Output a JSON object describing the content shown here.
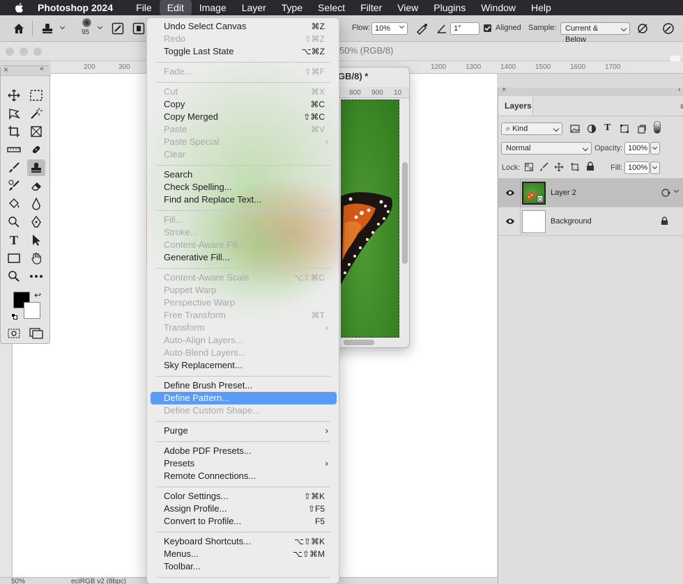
{
  "menubar": {
    "app_name": "Photoshop 2024",
    "items": [
      "File",
      "Edit",
      "Image",
      "Layer",
      "Type",
      "Select",
      "Filter",
      "View",
      "Plugins",
      "Window",
      "Help"
    ]
  },
  "options_bar": {
    "brush_size": "95",
    "flow_label": "Flow:",
    "flow_value": "10%",
    "angle_value": "1°",
    "aligned_label": "Aligned",
    "sample_label": "Sample:",
    "sample_value": "Current & Below"
  },
  "document": {
    "title_fragment": "50% (RGB/8)",
    "ruler_top": [
      "200",
      "300",
      "1200",
      "1300",
      "1400",
      "1500",
      "1600",
      "1700"
    ],
    "status_zoom": "50%",
    "status_profile": "eciRGB v2 (8bpc)"
  },
  "doc_window": {
    "title_fragment": "GB/8) *",
    "ruler": [
      "800",
      "900",
      "10"
    ]
  },
  "layers_panel": {
    "title": "Layers",
    "filter_kind": "Kind",
    "blend_mode": "Normal",
    "opacity_label": "Opacity:",
    "opacity_value": "100%",
    "lock_label": "Lock:",
    "fill_label": "Fill:",
    "fill_value": "100%",
    "layers": [
      {
        "name": "Layer 2"
      },
      {
        "name": "Background"
      }
    ]
  },
  "edit_menu": {
    "items": [
      {
        "label": "Undo Select Canvas",
        "shortcut": "⌘Z"
      },
      {
        "label": "Redo",
        "shortcut": "⇧⌘Z"
      },
      {
        "label": "Toggle Last State",
        "shortcut": "⌥⌘Z"
      },
      {
        "label": "Fade...",
        "shortcut": "⇧⌘F"
      },
      {
        "label": "Cut",
        "shortcut": "⌘X"
      },
      {
        "label": "Copy",
        "shortcut": "⌘C"
      },
      {
        "label": "Copy Merged",
        "shortcut": "⇧⌘C"
      },
      {
        "label": "Paste",
        "shortcut": "⌘V"
      },
      {
        "label": "Paste Special",
        "shortcut": ""
      },
      {
        "label": "Clear",
        "shortcut": ""
      },
      {
        "label": "Search",
        "shortcut": ""
      },
      {
        "label": "Check Spelling...",
        "shortcut": ""
      },
      {
        "label": "Find and Replace Text...",
        "shortcut": ""
      },
      {
        "label": "Fill...",
        "shortcut": ""
      },
      {
        "label": "Stroke...",
        "shortcut": ""
      },
      {
        "label": "Content-Aware Fill...",
        "shortcut": ""
      },
      {
        "label": "Generative Fill...",
        "shortcut": ""
      },
      {
        "label": "Content-Aware Scale",
        "shortcut": "⌥⇧⌘C"
      },
      {
        "label": "Puppet Warp",
        "shortcut": ""
      },
      {
        "label": "Perspective Warp",
        "shortcut": ""
      },
      {
        "label": "Free Transform",
        "shortcut": "⌘T"
      },
      {
        "label": "Transform",
        "shortcut": ""
      },
      {
        "label": "Auto-Align Layers...",
        "shortcut": ""
      },
      {
        "label": "Auto-Blend Layers...",
        "shortcut": ""
      },
      {
        "label": "Sky Replacement...",
        "shortcut": ""
      },
      {
        "label": "Define Brush Preset...",
        "shortcut": ""
      },
      {
        "label": "Define Pattern...",
        "shortcut": ""
      },
      {
        "label": "Define Custom Shape...",
        "shortcut": ""
      },
      {
        "label": "Purge",
        "shortcut": ""
      },
      {
        "label": "Adobe PDF Presets...",
        "shortcut": ""
      },
      {
        "label": "Presets",
        "shortcut": ""
      },
      {
        "label": "Remote Connections...",
        "shortcut": ""
      },
      {
        "label": "Color Settings...",
        "shortcut": "⇧⌘K"
      },
      {
        "label": "Assign Profile...",
        "shortcut": "⇧F5"
      },
      {
        "label": "Convert to Profile...",
        "shortcut": "F5"
      },
      {
        "label": "Keyboard Shortcuts...",
        "shortcut": "⌥⇧⌘K"
      },
      {
        "label": "Menus...",
        "shortcut": "⌥⇧⌘M"
      },
      {
        "label": "Toolbar...",
        "shortcut": ""
      }
    ]
  },
  "colors": {
    "menubar_bg": "#2a2a2e",
    "highlight": "#5a9bf6",
    "canvas_green": "#3c8726"
  }
}
